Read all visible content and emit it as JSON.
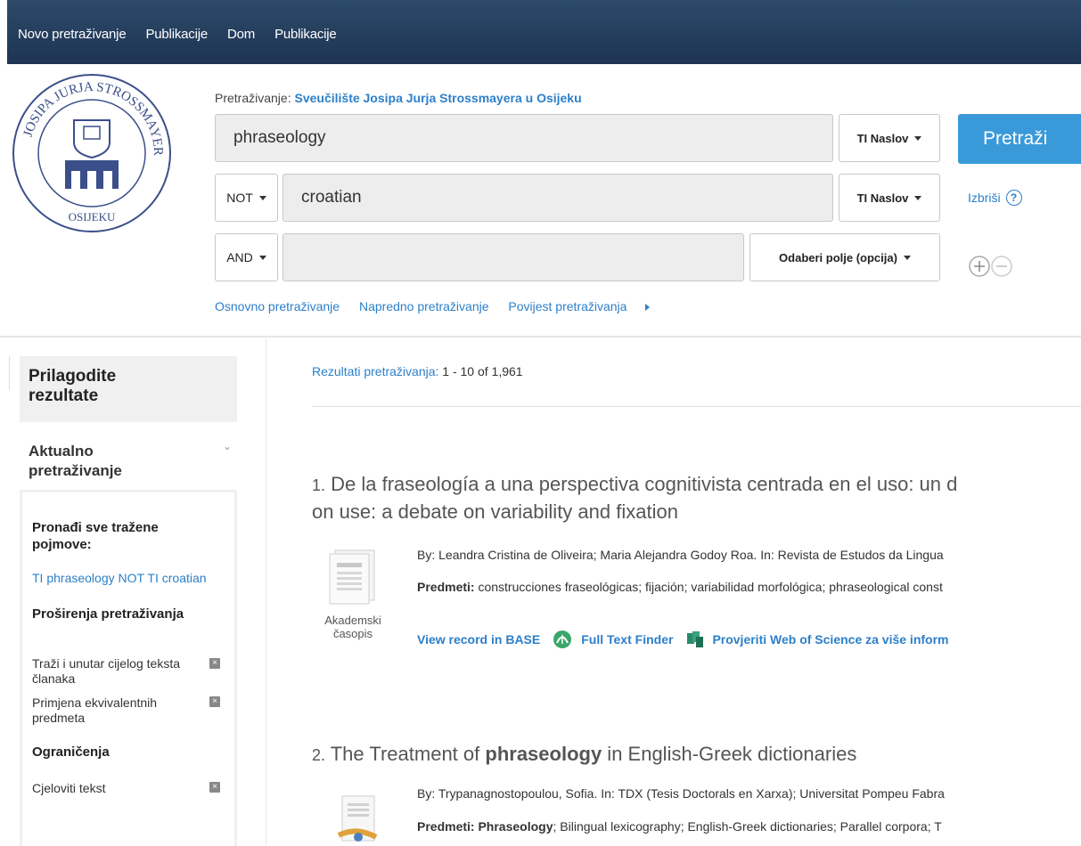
{
  "topnav": [
    "Novo pretraživanje",
    "Publikacije",
    "Dom",
    "Publikacije"
  ],
  "search": {
    "label_prefix": "Pretraživanje:",
    "institution": "Sveučilište Josipa Jurja Strossmayera u Osijeku",
    "row1": {
      "value": "phraseology",
      "field": "TI Naslov"
    },
    "row2": {
      "operator": "NOT",
      "value": "croatian",
      "field": "TI Naslov"
    },
    "row3": {
      "operator": "AND",
      "value": "",
      "field": "Odaberi polje (opcija)"
    },
    "search_button": "Pretraži",
    "clear": "Izbriši",
    "help": "?"
  },
  "links": {
    "basic": "Osnovno pretraživanje",
    "advanced": "Napredno pretraživanje",
    "history": "Povijest pretraživanja"
  },
  "sidebar": {
    "head": "Prilagodite rezultate",
    "current": "Aktualno pretraživanje",
    "find_all": "Pronađi sve tražene pojmove:",
    "query": "TI phraseology NOT TI croatian",
    "expanders_title": "Proširenja pretraživanja",
    "expander1": "Traži i unutar cijelog teksta članaka",
    "expander2": "Primjena ekvivalentnih predmeta",
    "limits_title": "Ograničenja",
    "limit1": "Cjeloviti tekst"
  },
  "results": {
    "label": "Rezultati pretraživanja:",
    "count": "1 - 10 of 1,961",
    "items": [
      {
        "num": "1.",
        "title_line1": "De la fraseología a una perspectiva cognitivista centrada en el uso: un d",
        "title_line2": "on use: a debate on variability and fixation",
        "by": "By: Leandra Cristina de Oliveira; Maria Alejandra Godoy Roa. In: Revista de Estudos da Lingua",
        "subjects_label": "Predmeti:",
        "subjects": " construcciones fraseológicas; fijación; variabilidad morfológica; phraseological const",
        "type_line1": "Akademski",
        "type_line2": "časopis",
        "action1": "View record in BASE",
        "action2": "Full Text Finder",
        "action3": "Provjeriti Web of Science za više inform"
      },
      {
        "num": "2.",
        "title_pre": "The Treatment of ",
        "title_bold": "phraseology",
        "title_post": " in English-Greek dictionaries",
        "by": "By: Trypanagnostopoulou, Sofia. In: TDX (Tesis Doctorals en Xarxa); Universitat Pompeu Fabra",
        "subjects_label": "Predmeti: ",
        "subjects_bold": "Phraseology",
        "subjects": "; Bilingual lexicography; English-Greek dictionaries; Parallel corpora; T"
      }
    ]
  },
  "colors": {
    "nav_bg": "#1e3452",
    "link": "#2c7fc9",
    "search_btn": "#3a9ad9"
  }
}
